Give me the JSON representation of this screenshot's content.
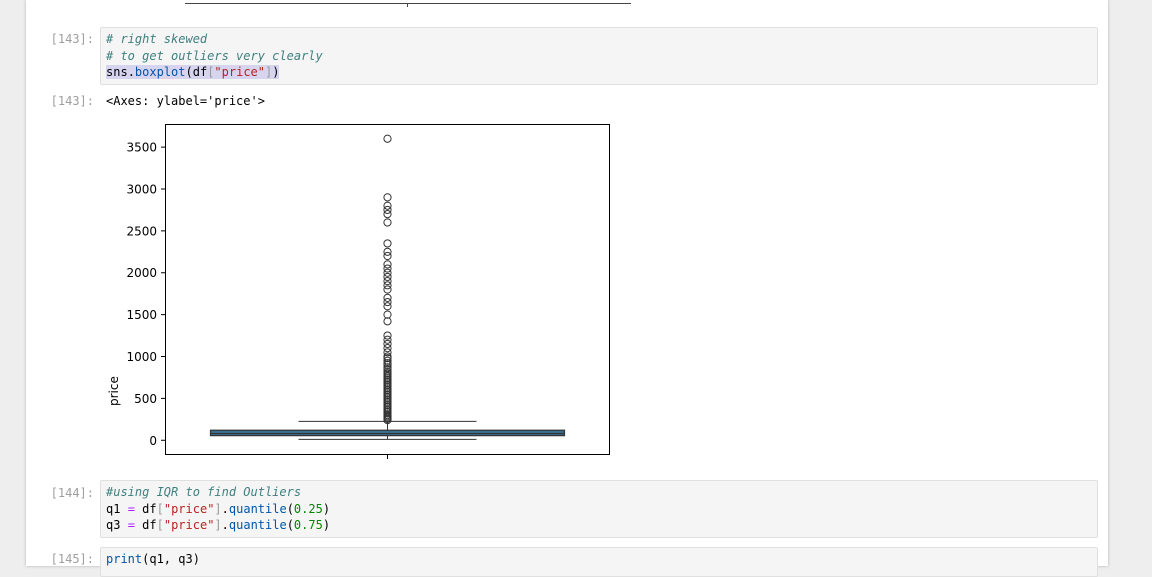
{
  "cells": [
    {
      "prompt": "[143]:",
      "code": [
        [
          {
            "t": "# right skewed",
            "c": "cm-comment"
          }
        ],
        [
          {
            "t": "# to get outliers very clearly",
            "c": "cm-comment"
          }
        ],
        [
          {
            "t": "sns",
            "c": "cm-var hl"
          },
          {
            "t": ".",
            "c": "cm-var hl"
          },
          {
            "t": "boxplot",
            "c": "cm-prop hl"
          },
          {
            "t": "(df",
            "c": "cm-var hl"
          },
          {
            "t": "[",
            "c": "cm-br hl"
          },
          {
            "t": "\"price\"",
            "c": "cm-str hl"
          },
          {
            "t": "]",
            "c": "cm-br hl"
          },
          {
            "t": ")",
            "c": "cm-var hl"
          }
        ]
      ],
      "out_prompt": "[143]:",
      "output": "<Axes: ylabel='price'>"
    },
    {
      "prompt": "[144]:",
      "code": [
        [
          {
            "t": "#using IQR to find Outliers",
            "c": "cm-comment"
          }
        ],
        [
          {
            "t": "q1 ",
            "c": "cm-var"
          },
          {
            "t": "=",
            "c": "cm-op"
          },
          {
            "t": " df",
            "c": "cm-var"
          },
          {
            "t": "[",
            "c": "cm-br"
          },
          {
            "t": "\"price\"",
            "c": "cm-str"
          },
          {
            "t": "]",
            "c": "cm-br"
          },
          {
            "t": ".",
            "c": "cm-var"
          },
          {
            "t": "quantile",
            "c": "cm-prop"
          },
          {
            "t": "(",
            "c": "cm-var"
          },
          {
            "t": "0.25",
            "c": "cm-num"
          },
          {
            "t": ")",
            "c": "cm-var"
          }
        ],
        [
          {
            "t": "q3 ",
            "c": "cm-var"
          },
          {
            "t": "=",
            "c": "cm-op"
          },
          {
            "t": " df",
            "c": "cm-var"
          },
          {
            "t": "[",
            "c": "cm-br"
          },
          {
            "t": "\"price\"",
            "c": "cm-str"
          },
          {
            "t": "]",
            "c": "cm-br"
          },
          {
            "t": ".",
            "c": "cm-var"
          },
          {
            "t": "quantile",
            "c": "cm-prop"
          },
          {
            "t": "(",
            "c": "cm-var"
          },
          {
            "t": "0.75",
            "c": "cm-num"
          },
          {
            "t": ")",
            "c": "cm-var"
          }
        ]
      ]
    },
    {
      "prompt": "[145]:",
      "code": [
        [
          {
            "t": "print",
            "c": "cm-prop"
          },
          {
            "t": "(q1, q3)",
            "c": "cm-var"
          }
        ]
      ]
    }
  ],
  "chart_data": {
    "type": "box",
    "ylabel": "price",
    "xlabel": "",
    "ylim": [
      -170,
      3770
    ],
    "yticks": [
      0,
      500,
      1000,
      1500,
      2000,
      2500,
      3000,
      3500
    ],
    "box": {
      "whisker_low": 10,
      "q1": 55,
      "median": 80,
      "q3": 120,
      "whisker_high": 225
    },
    "box_color": "#3a6e8f",
    "outliers": [
      3600,
      2900,
      2800,
      2750,
      2700,
      2600,
      2350,
      2250,
      2200,
      2100,
      2050,
      2000,
      1950,
      1900,
      1850,
      1800,
      1700,
      1650,
      1600,
      1500,
      1420,
      1250,
      1200,
      1150,
      1100,
      1050,
      1000,
      980,
      950,
      920,
      900,
      870,
      850,
      820,
      800,
      780,
      760,
      740,
      720,
      700,
      680,
      660,
      640,
      620,
      600,
      580,
      560,
      540,
      520,
      500,
      480,
      460,
      440,
      420,
      400,
      380,
      360,
      340,
      320,
      300,
      285,
      270,
      255,
      240
    ]
  }
}
